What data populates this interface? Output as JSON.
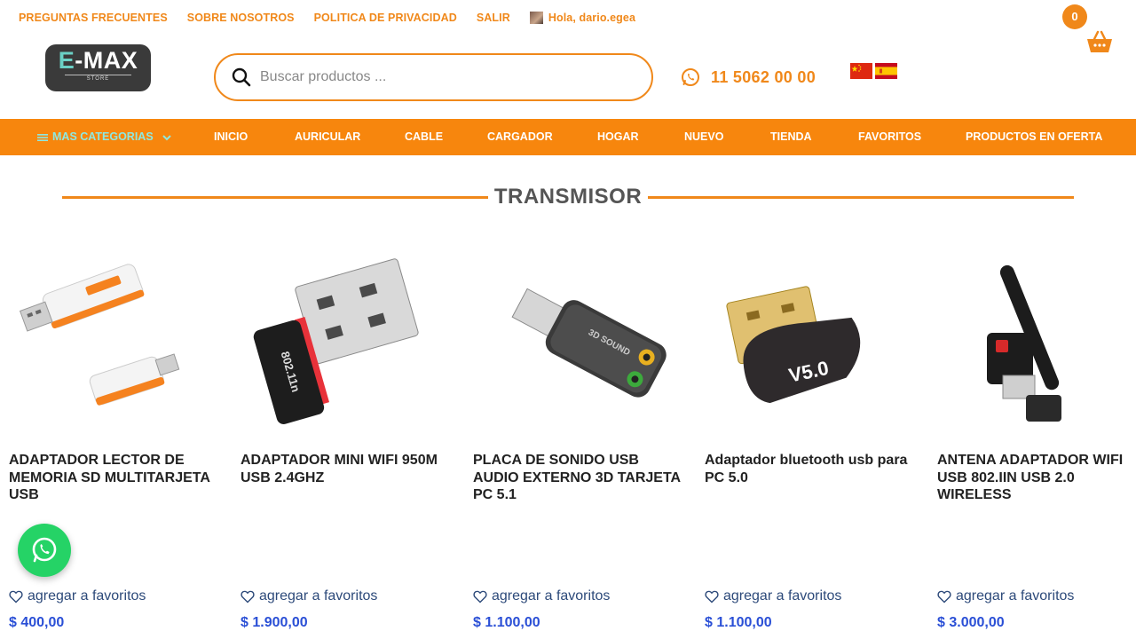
{
  "top_links": {
    "faq": "PREGUNTAS FRECUENTES",
    "about": "SOBRE NOSOTROS",
    "privacy": "POLITICA DE PRIVACIDAD",
    "logout": "SALIR",
    "greeting": "Hola, dario.egea"
  },
  "cart": {
    "count": "0"
  },
  "logo": {
    "brand_e": "E",
    "brand_rest": "-MAX",
    "sub": "STORE"
  },
  "search": {
    "placeholder": "Buscar productos ..."
  },
  "phone": {
    "number": "11 5062 00 00"
  },
  "flags": [
    "china-flag",
    "spain-flag"
  ],
  "nav": {
    "more_categories": "MAS CATEGORIAS",
    "items": [
      "INICIO",
      "AURICULAR",
      "CABLE",
      "CARGADOR",
      "HOGAR",
      "NUEVO",
      "TIENDA",
      "FAVORITOS",
      "PRODUCTOS EN OFERTA"
    ]
  },
  "section": {
    "title": "TRANSMISOR"
  },
  "products": [
    {
      "name": "ADAPTADOR LECTOR DE MEMORIA SD MULTITARJETA USB",
      "fav": "agregar a favoritos",
      "price": "$ 400,00"
    },
    {
      "name": "ADAPTADOR MINI WIFI 950M USB 2.4GHZ",
      "fav": "agregar a favoritos",
      "price": "$ 1.900,00"
    },
    {
      "name": "PLACA DE SONIDO USB AUDIO EXTERNO 3D TARJETA PC 5.1",
      "fav": "agregar a favoritos",
      "price": "$ 1.100,00"
    },
    {
      "name": "Adaptador bluetooth usb para PC 5.0",
      "fav": "agregar a favoritos",
      "price": "$ 1.100,00"
    },
    {
      "name": "ANTENA ADAPTADOR WIFI USB 802.IIN USB 2.0 WIRELESS",
      "fav": "agregar a favoritos",
      "price": "$ 3.000,00"
    }
  ],
  "product_image_labels": [
    "802.11n",
    "3D SOUND",
    "V5.0"
  ],
  "colors": {
    "accent": "#f7860d",
    "price": "#2a4fd6",
    "whatsapp": "#25d366"
  }
}
